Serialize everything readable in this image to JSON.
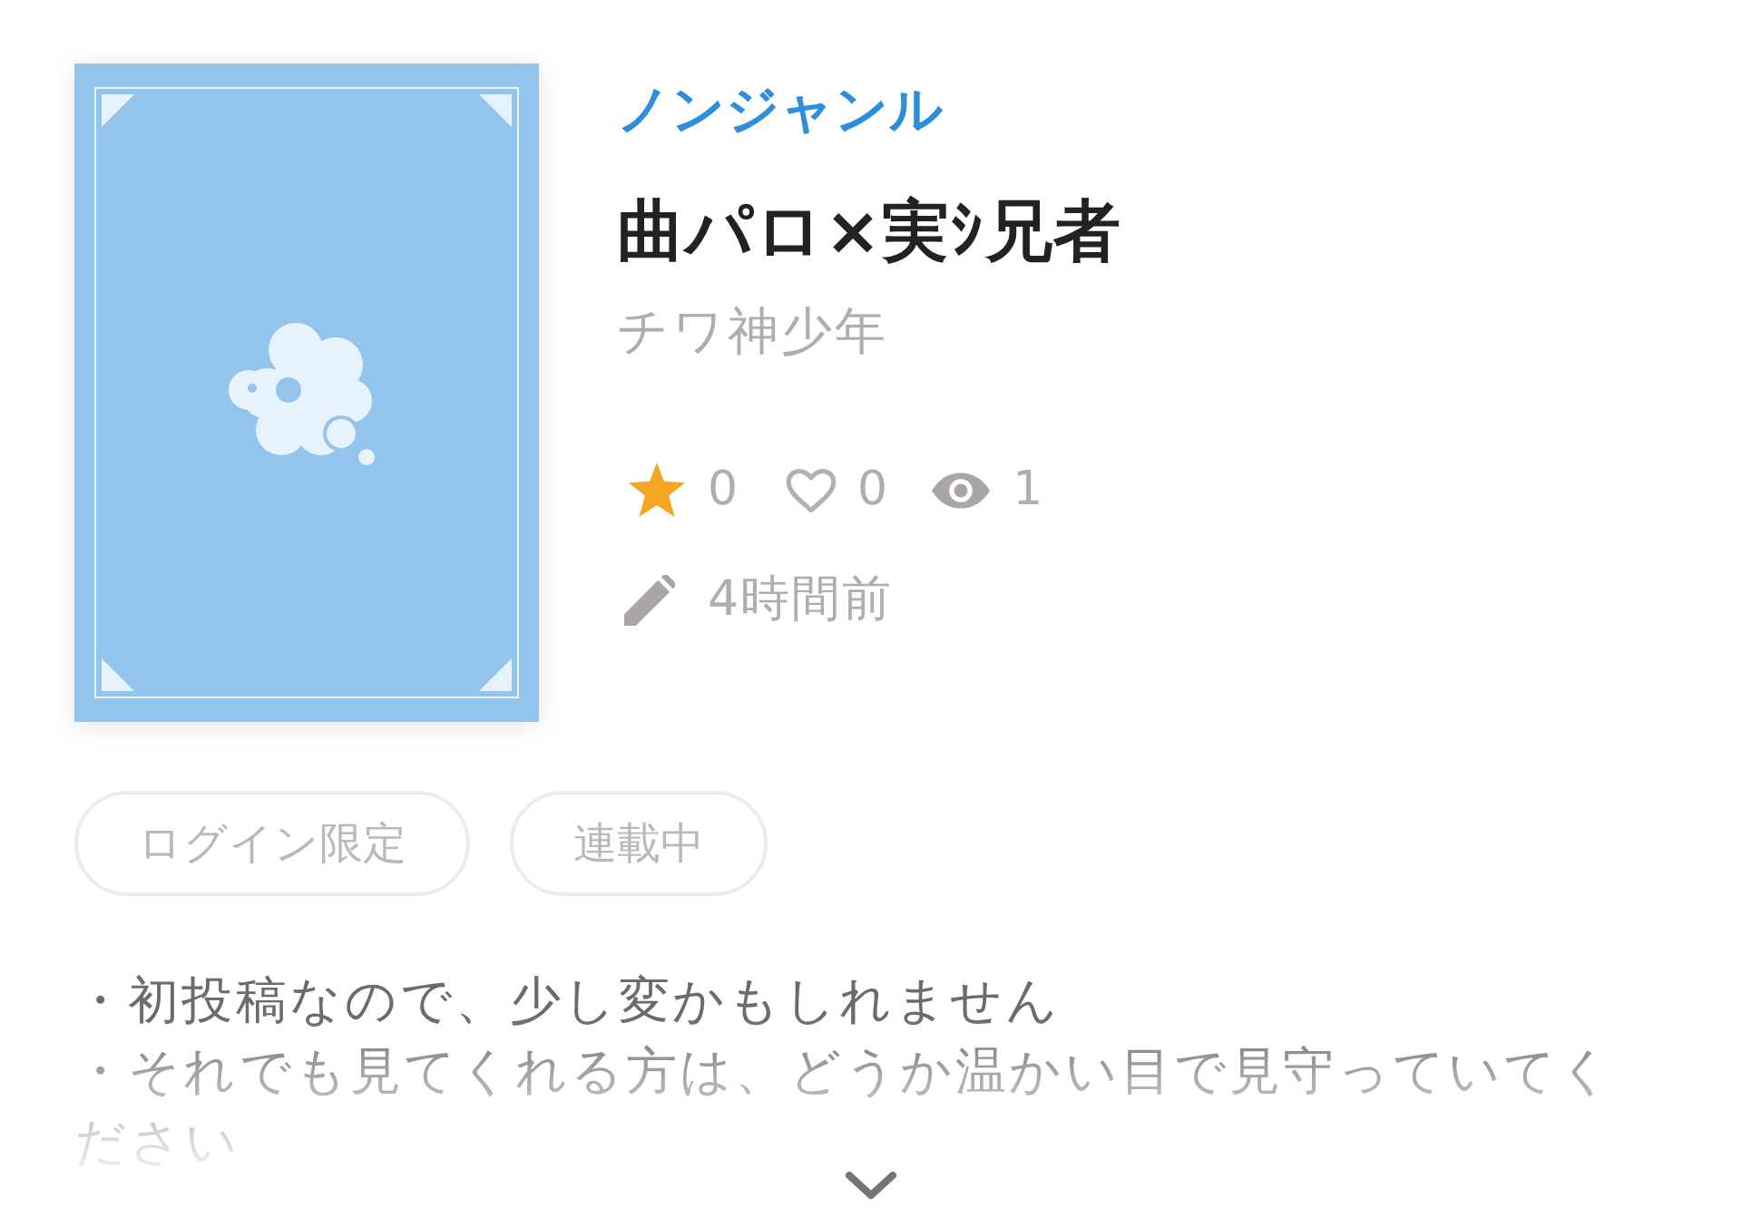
{
  "work": {
    "genre": "ノンジャンル",
    "title": "曲パロ×実ｼ兄者",
    "author": "チワ神少年",
    "stats": {
      "favorites": "0",
      "likes": "0",
      "views": "1"
    },
    "updated": "4時間前"
  },
  "tags": [
    "ログイン限定",
    "連載中"
  ],
  "description": {
    "lines": [
      "・初投稿なので、少し変かもしれません",
      "・それでも見てくれる方は、どうか温かい目で見守っていてください"
    ],
    "collapsed": true
  }
}
